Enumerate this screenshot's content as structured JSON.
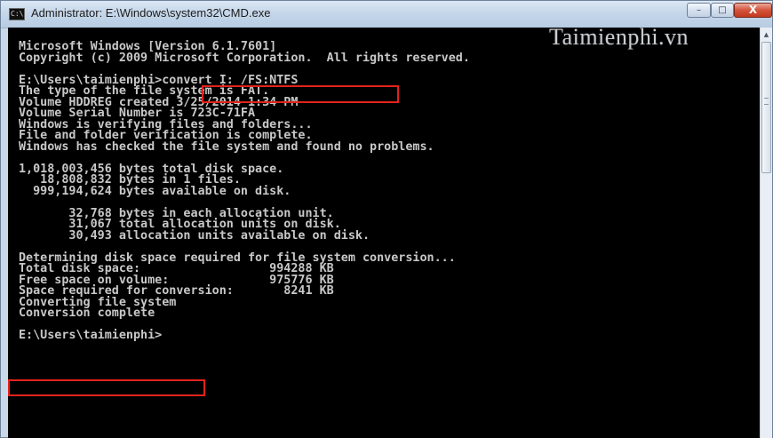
{
  "window": {
    "title": "Administrator: E:\\Windows\\system32\\CMD.exe",
    "icon": "cmd-console-icon",
    "watermark": "Taimienphi.vn",
    "buttons": {
      "minimize": "–",
      "maximize": "□",
      "close": "X"
    }
  },
  "console": {
    "text_color": "#c8c8c8",
    "background": "#000000",
    "highlight_color": "#e3231c",
    "lines": [
      "Microsoft Windows [Version 6.1.7601]",
      "Copyright (c) 2009 Microsoft Corporation.  All rights reserved.",
      "",
      "E:\\Users\\taimienphi>convert I: /FS:NTFS",
      "The type of the file system is FAT.",
      "Volume HDDREG created 3/25/2014 1:34 PM",
      "Volume Serial Number is 723C-71FA",
      "Windows is verifying files and folders...",
      "File and folder verification is complete.",
      "Windows has checked the file system and found no problems.",
      "",
      "1,018,003,456 bytes total disk space.",
      "   18,808,832 bytes in 1 files.",
      "  999,194,624 bytes available on disk.",
      "",
      "       32,768 bytes in each allocation unit.",
      "       31,067 total allocation units on disk.",
      "       30,493 allocation units available on disk.",
      "",
      "Determining disk space required for file system conversion...",
      "Total disk space:                  994288 KB",
      "Free space on volume:              975776 KB",
      "Space required for conversion:       8241 KB",
      "Converting file system",
      "Conversion complete",
      "",
      "E:\\Users\\taimienphi>"
    ]
  }
}
